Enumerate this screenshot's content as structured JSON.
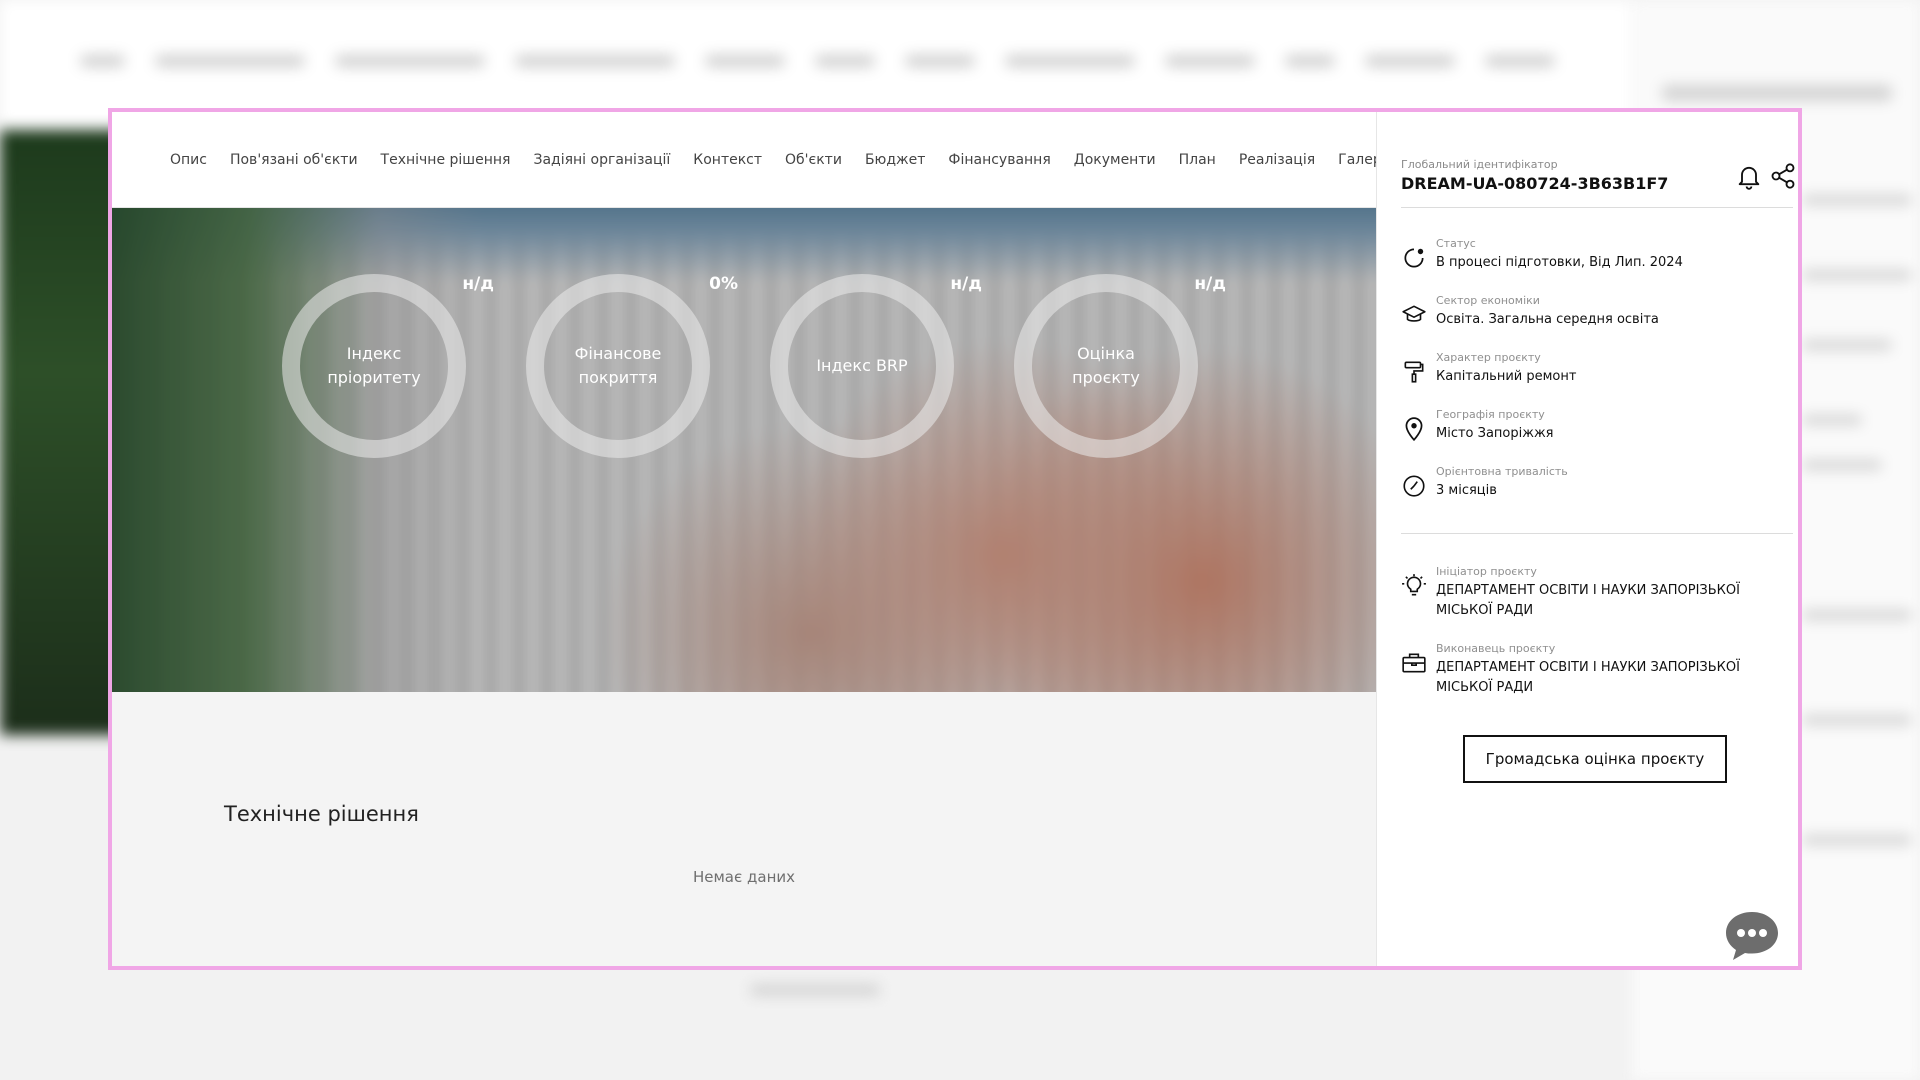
{
  "tabs": [
    "Опис",
    "Пов'язані об'єкти",
    "Технічне рішення",
    "Задіяні організації",
    "Контекст",
    "Об'єкти",
    "Бюджет",
    "Фінансування",
    "Документи",
    "План",
    "Реалізація",
    "Галерея"
  ],
  "indicators": [
    {
      "label": "Індекс пріоритету",
      "value": "н/д"
    },
    {
      "label": "Фінансове покриття",
      "value": "0%"
    },
    {
      "label": "Індекс BRP",
      "value": "н/д"
    },
    {
      "label": "Оцінка проєкту",
      "value": "н/д"
    }
  ],
  "section": {
    "title": "Технічне рішення",
    "empty": "Немає даних"
  },
  "sidebar": {
    "global_id_label": "Глобальний ідентифікатор",
    "global_id": "DREAM-UA-080724-3B63B1F7",
    "status": {
      "label": "Статус",
      "value": "В процесі підготовки, Від Лип. 2024"
    },
    "sector": {
      "label": "Сектор економіки",
      "value": "Освіта. Загальна середня освіта"
    },
    "nature": {
      "label": "Характер проєкту",
      "value": "Капітальний ремонт"
    },
    "geography": {
      "label": "Географія проєкту",
      "value": "Місто Запоріжжя"
    },
    "duration": {
      "label": "Орієнтовна тривалість",
      "value": "3 місяців"
    },
    "initiator": {
      "label": "Ініціатор проєкту",
      "value": "ДЕПАРТАМЕНТ ОСВІТИ І НАУКИ ЗАПОРІЗЬКОЇ МІСЬКОЇ РАДИ"
    },
    "executor": {
      "label": "Виконавець проєкту",
      "value": "ДЕПАРТАМЕНТ ОСВІТИ І НАУКИ ЗАПОРІЗЬКОЇ МІСЬКОЇ РАДИ"
    },
    "rate_button": "Громадська оцінка проєкту"
  },
  "icons": {
    "bell": "bell-icon",
    "share": "share-icon",
    "status": "status-icon",
    "sector": "graduation-cap-icon",
    "nature": "paint-roller-icon",
    "geography": "map-pin-icon",
    "duration": "clock-icon",
    "initiator": "lightbulb-icon",
    "executor": "briefcase-icon",
    "chat": "chat-icon"
  },
  "colors": {
    "modal_border": "#f0a6e6",
    "chat_button": "#6d6d6d"
  }
}
